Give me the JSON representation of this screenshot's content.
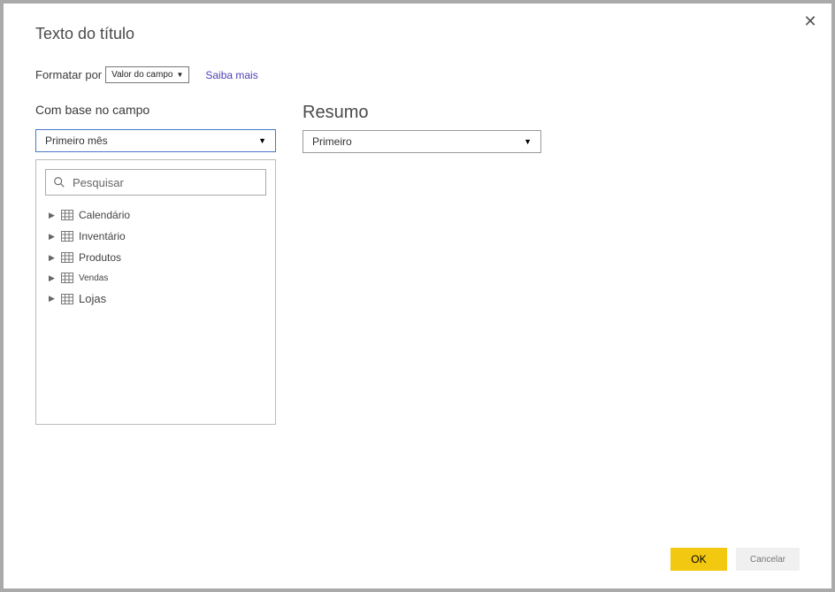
{
  "dialog": {
    "title": "Texto do título",
    "formatByLabel": "Formatar por",
    "formatByValue": "Valor do campo",
    "learnMore": "Saiba mais",
    "fieldLabel": "Com base no campo",
    "fieldValue": "Primeiro mês",
    "resumoTitle": "Resumo",
    "resumoValue": "Primeiro",
    "searchPlaceholder": "Pesquisar",
    "tree": {
      "item0": "Calendário",
      "item1": "Inventário",
      "item2": "Produtos",
      "item3": "Vendas",
      "item4": "Lojas"
    },
    "okLabel": "OK",
    "cancelLabel": "Cancelar"
  }
}
